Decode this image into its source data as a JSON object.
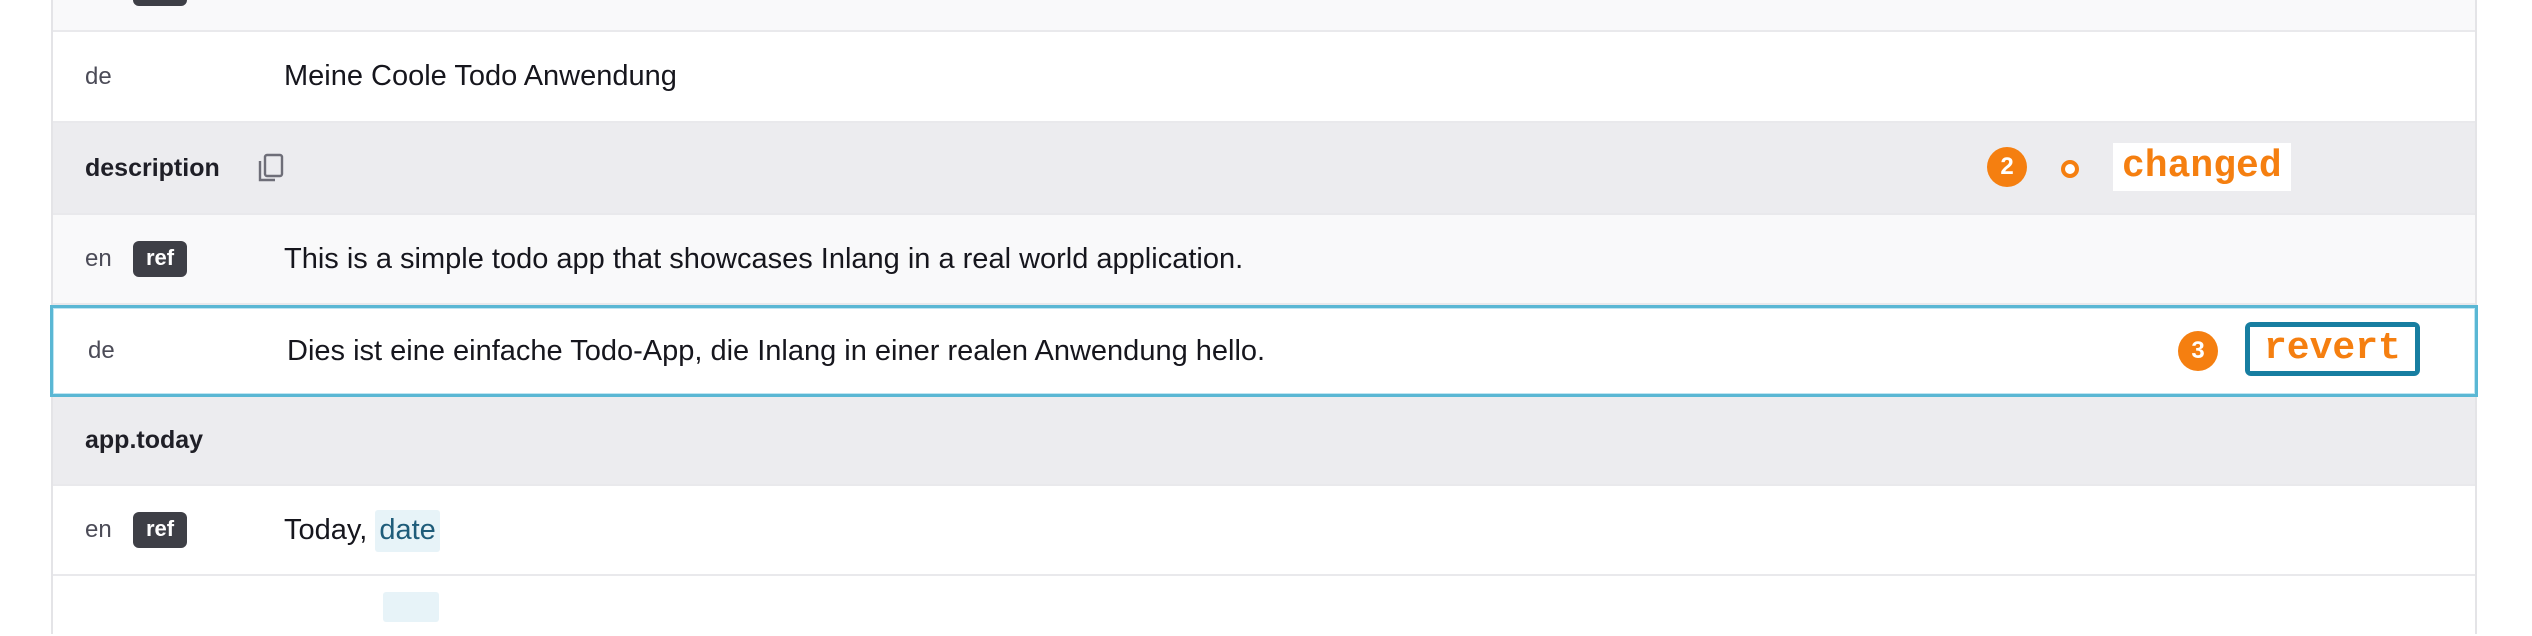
{
  "rows": {
    "top": {
      "lang": "",
      "ref_badge": "ref"
    },
    "title_de": {
      "lang": "de",
      "text": "Meine Coole Todo Anwendung"
    },
    "description_key": {
      "key": "description",
      "icon": "copy-icon"
    },
    "description_en": {
      "lang": "en",
      "ref_badge": "ref",
      "text": "This is a simple todo app that showcases Inlang in a real world application."
    },
    "description_de": {
      "lang": "de",
      "text": "Dies ist eine einfache Todo-App, die Inlang in einer realen Anwendung hello."
    },
    "today_key": {
      "key": "app.today"
    },
    "today_en": {
      "lang": "en",
      "ref_badge": "ref",
      "text_prefix": "Today, ",
      "variable": "date"
    }
  },
  "annotations": {
    "step_changed": {
      "number": "2",
      "label": "changed"
    },
    "step_revert": {
      "number": "3",
      "label": "revert"
    }
  },
  "colors": {
    "accent_orange": "#f57f10",
    "active_border": "#5ab7d4",
    "revert_border": "#177ea1",
    "ref_badge_bg": "#3e3f46",
    "variable_bg": "#e7f3f8"
  }
}
